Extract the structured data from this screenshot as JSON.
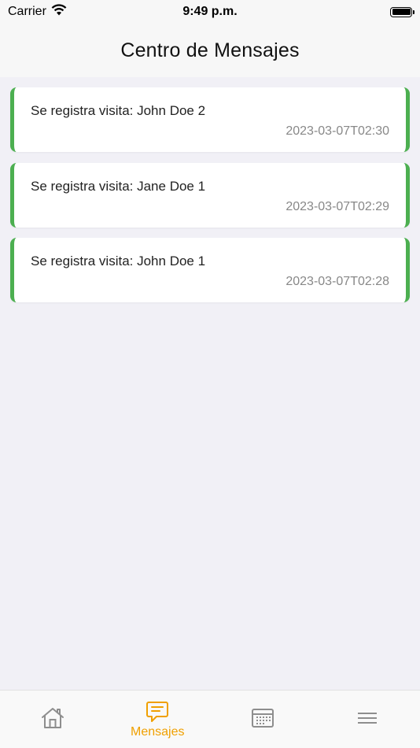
{
  "status_bar": {
    "carrier": "Carrier",
    "time": "9:49 p.m."
  },
  "header": {
    "title": "Centro de Mensajes"
  },
  "messages": [
    {
      "text": "Se registra visita: John Doe 2",
      "timestamp": "2023-03-07T02:30"
    },
    {
      "text": "Se registra visita: Jane Doe 1",
      "timestamp": "2023-03-07T02:29"
    },
    {
      "text": "Se registra visita: John Doe 1",
      "timestamp": "2023-03-07T02:28"
    }
  ],
  "tab_bar": {
    "tabs": [
      {
        "icon": "home-icon",
        "label": ""
      },
      {
        "icon": "message-icon",
        "label": "Mensajes",
        "active": true
      },
      {
        "icon": "calendar-icon",
        "label": ""
      },
      {
        "icon": "menu-icon",
        "label": ""
      }
    ]
  },
  "colors": {
    "accent": "#f0a000",
    "card_border": "#4caf50",
    "inactive_icon": "#8e8e8e",
    "background": "#f1f0f6"
  }
}
